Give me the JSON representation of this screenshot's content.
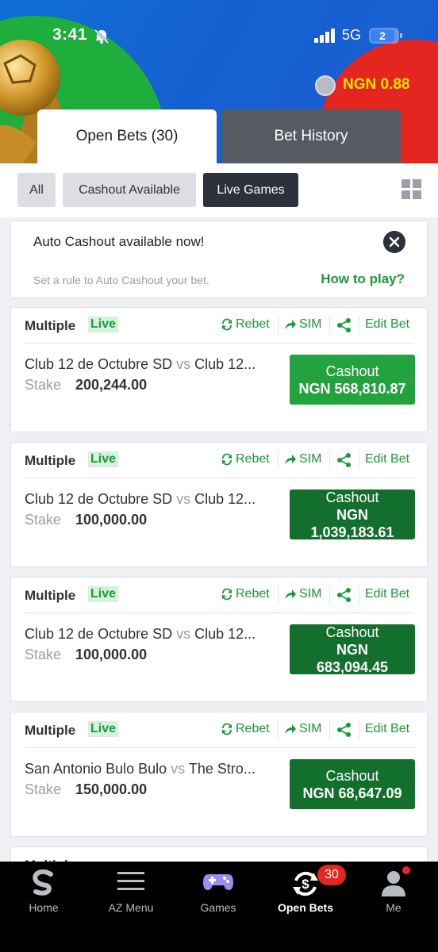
{
  "status_bar": {
    "time": "3:41",
    "network": "5G",
    "battery": "2"
  },
  "account": {
    "balance": "NGN 0.88"
  },
  "tabs": [
    {
      "label": "Open Bets (30)"
    },
    {
      "label": "Bet History"
    }
  ],
  "filters": [
    {
      "label": "All"
    },
    {
      "label": "Cashout Available"
    },
    {
      "label": "Live Games"
    }
  ],
  "banner": {
    "title": "Auto Cashout available now!",
    "subtitle": "Set a rule to Auto Cashout your bet.",
    "link": "How to play?"
  },
  "card_labels": {
    "type": "Multiple",
    "live": "Live",
    "rebet": "Rebet",
    "sim": "SIM",
    "edit": "Edit Bet",
    "stake": "Stake",
    "cashout": "Cashout"
  },
  "bets": [
    {
      "home": "Club 12 de Octubre SD",
      "vs": "vs",
      "away": "Club 12...",
      "stake": "200,244.00",
      "cash_line1": "Cashout",
      "cash_line2": "NGN 568,810.87",
      "cash_line3": ""
    },
    {
      "home": "Club 12 de Octubre SD",
      "vs": "vs",
      "away": "Club 12...",
      "stake": "100,000.00",
      "cash_line1": "Cashout",
      "cash_line2": "NGN",
      "cash_line3": "1,039,183.61"
    },
    {
      "home": "Club 12 de Octubre SD",
      "vs": "vs",
      "away": "Club 12...",
      "stake": "100,000.00",
      "cash_line1": "Cashout",
      "cash_line2": "NGN",
      "cash_line3": "683,094.45"
    },
    {
      "home": "San Antonio Bulo Bulo",
      "vs": "vs",
      "away": "The Stro...",
      "stake": "150,000.00",
      "cash_line1": "Cashout",
      "cash_line2": "NGN 68,647.09",
      "cash_line3": ""
    }
  ],
  "nav": [
    {
      "label": "Home",
      "icon": "sporty-logo-icon"
    },
    {
      "label": "AZ Menu",
      "icon": "hamburger-menu-icon"
    },
    {
      "label": "Games",
      "icon": "gamepad-icon"
    },
    {
      "label": "Open Bets",
      "icon": "open-bets-icon",
      "badge": "30"
    },
    {
      "label": "Me",
      "icon": "user-icon"
    }
  ],
  "colors": {
    "green": "#1a9a3a",
    "cashout_bright": "#22a33d",
    "cashout_dark": "#12702c",
    "dark": "#2d3139",
    "badge_red": "#e3261f"
  }
}
